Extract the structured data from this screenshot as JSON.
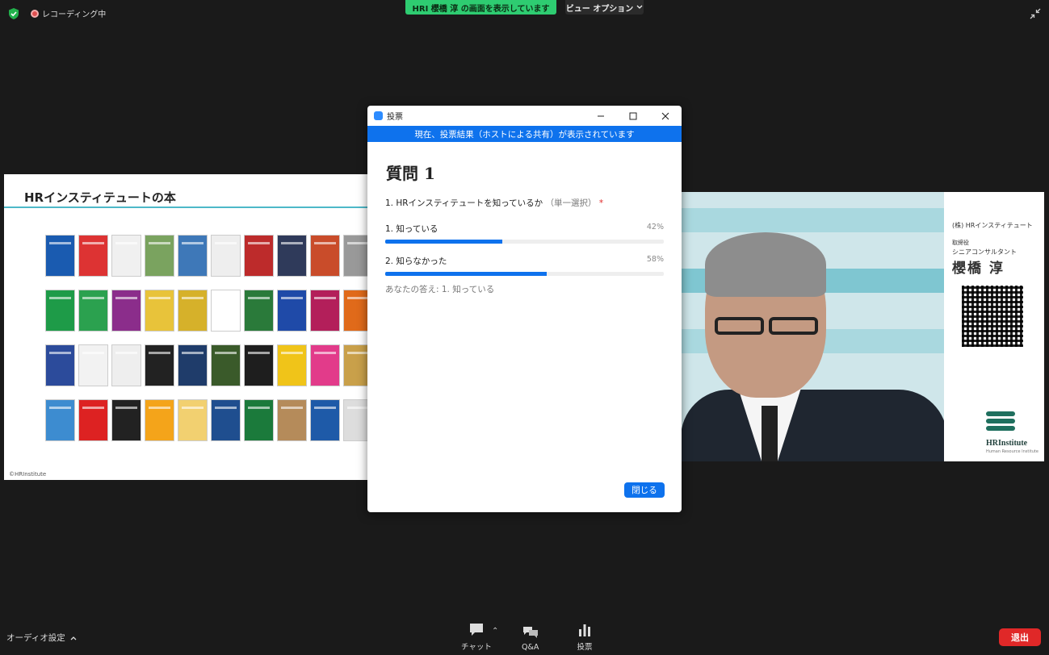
{
  "top": {
    "recording_label": "レコーディング中",
    "share_banner": "HRI 櫻橋 淳 の画面を表示しています",
    "view_options": "ビュー オプション"
  },
  "slide": {
    "title": "HRインスティテュートの本",
    "copyright": "©HRInstitute",
    "book_colors": [
      "#1a5bb0",
      "#d33",
      "#f0f0f0",
      "#7aa35f",
      "#3e78b8",
      "#eee",
      "#bd2b2b",
      "#2f3a5a",
      "#c94c2a",
      "#999",
      "#1e9b48",
      "#2ba14f",
      "#8b2d8b",
      "#e8c33a",
      "#d6b12a",
      "#fff",
      "#2a7a3a",
      "#1f4aa8",
      "#b31f5a",
      "#e06a1a",
      "#2c4b9b",
      "#f2f2f2",
      "#eee",
      "#222",
      "#1f3c6a",
      "#3a5a2a",
      "#1e1e1e",
      "#f0c419",
      "#e23b8a",
      "#c9a04a",
      "#3d8cd0",
      "#d22",
      "#222",
      "#f4a41a",
      "#f2d070",
      "#1f4e8f",
      "#1b7a3b",
      "#b58b5a",
      "#1e5aa8",
      "#ddd"
    ]
  },
  "dialog": {
    "window_title": "投票",
    "banner": "現在、投票結果（ホストによる共有）が表示されています",
    "question_title": "質問 1",
    "question_text": "1. HRインスティテュートを知っているか",
    "question_mode": "（単一選択）",
    "required_mark": "*",
    "options": [
      {
        "label": "1. 知っている",
        "percent_label": "42%",
        "percent": 42
      },
      {
        "label": "2. 知らなかった",
        "percent_label": "58%",
        "percent": 58
      }
    ],
    "your_answer": "あなたの答え: 1. 知っている",
    "close_label": "閉じる"
  },
  "video": {
    "card_company": "(株) HRインスティテュート",
    "card_role1": "取締役",
    "card_role2": "シニアコンサルタント",
    "card_name": "櫻橋 淳",
    "card_brand": "HRInstitute",
    "card_sub": "Human Resource Institute"
  },
  "toolbar": {
    "audio_settings": "オーディオ設定",
    "chat": "チャット",
    "qa": "Q&A",
    "poll": "投票",
    "leave": "退出"
  },
  "colors": {
    "zoom_blue": "#0e72ed",
    "share_green": "#2ecc71",
    "leave_red": "#e02828"
  }
}
